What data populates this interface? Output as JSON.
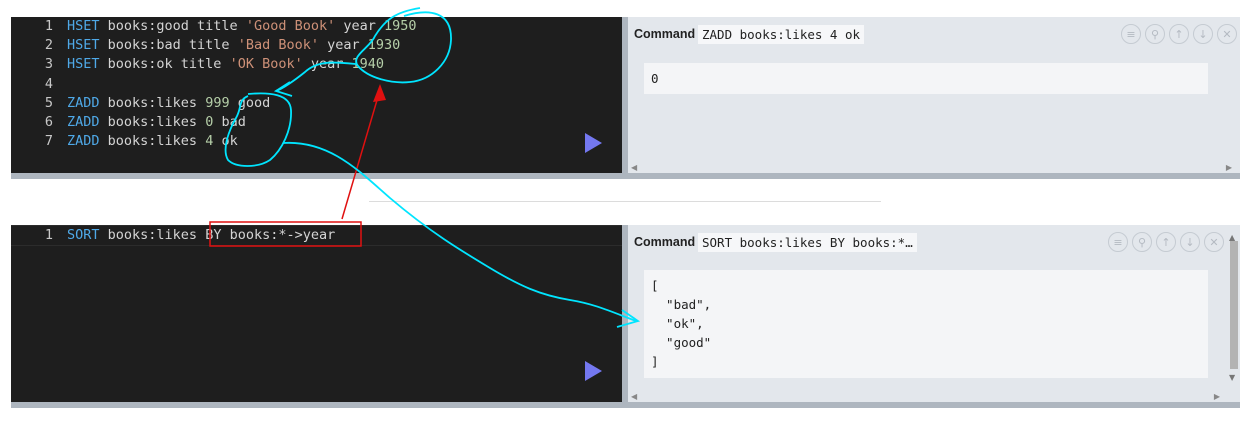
{
  "block1": {
    "lines": [
      {
        "n": "1",
        "parts": [
          [
            "kw",
            "HSET"
          ],
          [
            "t",
            " books:good title "
          ],
          [
            "str",
            "'Good Book'"
          ],
          [
            "t",
            " year "
          ],
          [
            "num",
            "1950"
          ]
        ]
      },
      {
        "n": "2",
        "parts": [
          [
            "kw",
            "HSET"
          ],
          [
            "t",
            " books:bad title "
          ],
          [
            "str",
            "'Bad Book'"
          ],
          [
            "t",
            " year "
          ],
          [
            "num",
            "1930"
          ]
        ]
      },
      {
        "n": "3",
        "parts": [
          [
            "kw",
            "HSET"
          ],
          [
            "t",
            " books:ok title "
          ],
          [
            "str",
            "'OK Book'"
          ],
          [
            "t",
            " year "
          ],
          [
            "num",
            "1940"
          ]
        ]
      },
      {
        "n": "4",
        "parts": []
      },
      {
        "n": "5",
        "parts": [
          [
            "kw",
            "ZADD"
          ],
          [
            "t",
            " books:likes "
          ],
          [
            "num",
            "999"
          ],
          [
            "t",
            " good"
          ]
        ]
      },
      {
        "n": "6",
        "parts": [
          [
            "kw",
            "ZADD"
          ],
          [
            "t",
            " books:likes "
          ],
          [
            "num",
            "0"
          ],
          [
            "t",
            " bad"
          ]
        ]
      },
      {
        "n": "7",
        "parts": [
          [
            "kw",
            "ZADD"
          ],
          [
            "t",
            " books:likes "
          ],
          [
            "num",
            "4"
          ],
          [
            "t",
            " ok"
          ]
        ]
      }
    ],
    "command_label": "Command",
    "command_text": "ZADD books:likes 4 ok",
    "output": [
      "0"
    ]
  },
  "block2": {
    "lines": [
      {
        "n": "1",
        "parts": [
          [
            "kw",
            "SORT"
          ],
          [
            "t",
            " books:likes "
          ],
          [
            "t",
            "BY books:*->year"
          ]
        ]
      }
    ],
    "command_label": "Command",
    "command_text": "SORT books:likes BY books:*…",
    "output": [
      "[",
      "  \"bad\",",
      "  \"ok\",",
      "  \"good\"",
      "]"
    ]
  },
  "icons": [
    "list-icon",
    "pin-icon",
    "arrow-up-icon",
    "arrow-down-icon",
    "close-icon"
  ],
  "icon_glyphs": [
    "≡",
    "⚲",
    "↑",
    "↓",
    "✕"
  ],
  "colors": {
    "keyword": "#4fa9e8",
    "string": "#ce9178",
    "number": "#b5cea8",
    "run": "#7478f0",
    "annotation_cyan": "#00e5ff",
    "annotation_red": "#e01010"
  }
}
